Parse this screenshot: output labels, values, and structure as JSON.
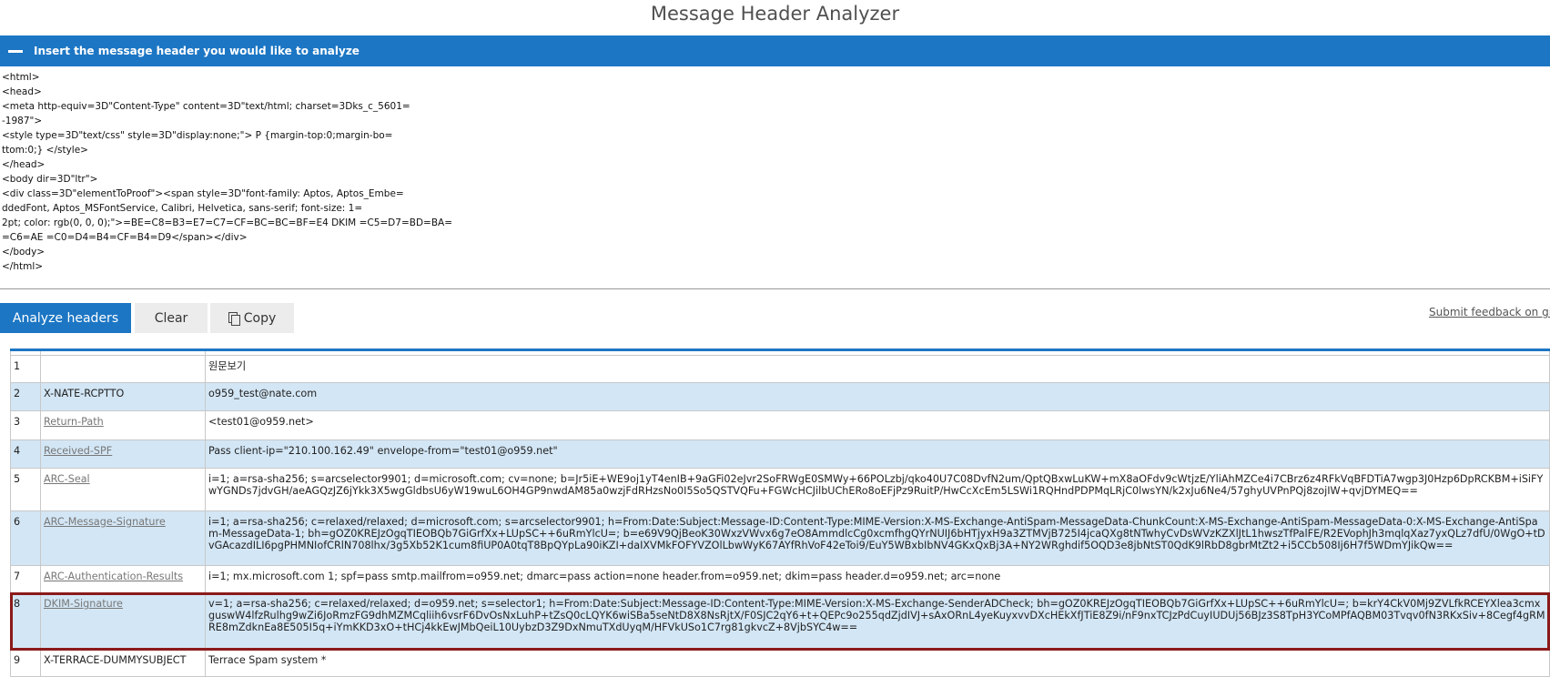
{
  "title": "Message Header Analyzer",
  "banner": {
    "text": "Insert the message header you would like to analyze"
  },
  "raw_header": "<html>\n<head>\n<meta http-equiv=3D\"Content-Type\" content=3D\"text/html; charset=3Dks_c_5601=\n-1987\">\n<style type=3D\"text/css\" style=3D\"display:none;\"> P {margin-top:0;margin-bo=\nttom:0;} </style>\n</head>\n<body dir=3D\"ltr\">\n<div class=3D\"elementToProof\"><span style=3D\"font-family: Aptos, Aptos_Embe=\nddedFont, Aptos_MSFontService, Calibri, Helvetica, sans-serif; font-size: 1=\n2pt; color: rgb(0, 0, 0);\">=BE=C8=B3=E7=C7=CF=BC=BC=BF=E4 DKIM =C5=D7=BD=BA=\n=C6=AE =C0=D4=B4=CF=B4=D9</span></div>\n</body>\n</html>",
  "toolbar": {
    "analyze_label": "Analyze headers",
    "clear_label": "Clear",
    "copy_label": "Copy"
  },
  "feedback": "Submit feedback on github",
  "colors": {
    "accent": "#1c76c4",
    "row_alt": "#d3e6f5",
    "highlight": "#8b1a1a"
  },
  "rows": [
    {
      "num": "1",
      "name": "",
      "value": "원문보기"
    },
    {
      "num": "2",
      "name": "X-NATE-RCPTTO",
      "value": "o959_test@nate.com"
    },
    {
      "num": "3",
      "name": "Return-Path",
      "value": "<test01@o959.net>"
    },
    {
      "num": "4",
      "name": "Received-SPF",
      "value": "Pass client-ip=\"210.100.162.49\" envelope-from=\"test01@o959.net\""
    },
    {
      "num": "5",
      "name": "ARC-Seal",
      "value": "i=1; a=rsa-sha256; s=arcselector9901; d=microsoft.com; cv=none; b=Jr5iE+WE9oj1yT4enIB+9aGFi02eJvr2SoFRWgE0SMWy+66POLzbj/qko40U7C08DvfN2um/QptQBxwLuKW+mX8aOFdv9cWtjzE/YliAhMZCe4i7CBrz6z4RFkVqBFDTiA7wgp3J0Hzp6DpRCKBM+iSiFYwYGNDs7jdvGH/aeAGQzJZ6jYkk3X5wgGldbsU6yW19wuL6OH4GP9nwdAM85a0wzjFdRHzsNo0I5So5QSTVQFu+FGWcHCJilbUChERo8oEFjPz9RuitP/HwCcXcEm5LSWi1RQHndPDPMqLRjC0lwsYN/k2xJu6Ne4/57ghyUVPnPQj8zojIW+qvjDYMEQ=="
    },
    {
      "num": "6",
      "name": "ARC-Message-Signature",
      "value": "i=1; a=rsa-sha256; c=relaxed/relaxed; d=microsoft.com; s=arcselector9901; h=From:Date:Subject:Message-ID:Content-Type:MIME-Version:X-MS-Exchange-AntiSpam-MessageData-ChunkCount:X-MS-Exchange-AntiSpam-MessageData-0:X-MS-Exchange-AntiSpam-MessageData-1; bh=gOZ0KREJzOgqTIEOBQb7GiGrfXx+LUpSC++6uRmYlcU=; b=e69V9QjBeoK30WxzVWvx6g7eO8AmmdlcCg0xcmfhgQYrNUIJ6bHTjyxH9a3ZTMVjB725I4jcaQXg8tNTwhyCvDsWVzKZXlJtL1hwszTfPalFE/R2EVophJh3mqlqXaz7yxQLz7dfU/0WgO+tDvGAcazdILI6pgPHMNIofCRlN708lhx/3g5Xb52K1cum8fiUP0A0tqT8BpQYpLa90iKZI+daIXVMkFOFYVZOlLbwWyK67AYfRhVoF42eToi9/EuY5WBxbIbNV4GKxQxBj3A+NY2WRghdif5OQD3e8jbNtST0QdK9lRbD8gbrMtZt2+i5CCb508Ij6H7f5WDmYJikQw=="
    },
    {
      "num": "7",
      "name": "ARC-Authentication-Results",
      "value": "i=1; mx.microsoft.com 1; spf=pass smtp.mailfrom=o959.net; dmarc=pass action=none header.from=o959.net; dkim=pass header.d=o959.net; arc=none"
    },
    {
      "num": "8",
      "name": "DKIM-Signature",
      "value": "v=1; a=rsa-sha256; c=relaxed/relaxed; d=o959.net; s=selector1; h=From:Date:Subject:Message-ID:Content-Type:MIME-Version:X-MS-Exchange-SenderADCheck; bh=gOZ0KREJzOgqTIEOBQb7GiGrfXx+LUpSC++6uRmYlcU=; b=krY4CkV0Mj9ZVLfkRCEYXlea3cmxguswW4lfzRulhg9wZi6JoRmzFG9dhMZMCqliih6vsrF6DvOsNxLuhP+tZsQ0cLQYK6wiSBa5seNtD8X8NsRjtX/F0SJC2qY6+t+QEPc9o255qdZjdIVJ+sAxORnL4yeKuyxvvDXcHEkXfJTiE8Z9i/nF9nxTCJzPdCuyIUDUj56BJz3S8TpH3YCoMPfAQBM03Tvqv0fN3RKxSiv+8Cegf4gRMRE8mZdknEa8E505I5q+iYmKKD3xO+tHCj4kkEwJMbQeiL10UybzD3Z9DxNmuTXdUyqM/HFVkUSo1C7rg81gkvcZ+8VjbSYC4w=="
    },
    {
      "num": "9",
      "name": "X-TERRACE-DUMMYSUBJECT",
      "value": "Terrace Spam system *"
    }
  ]
}
